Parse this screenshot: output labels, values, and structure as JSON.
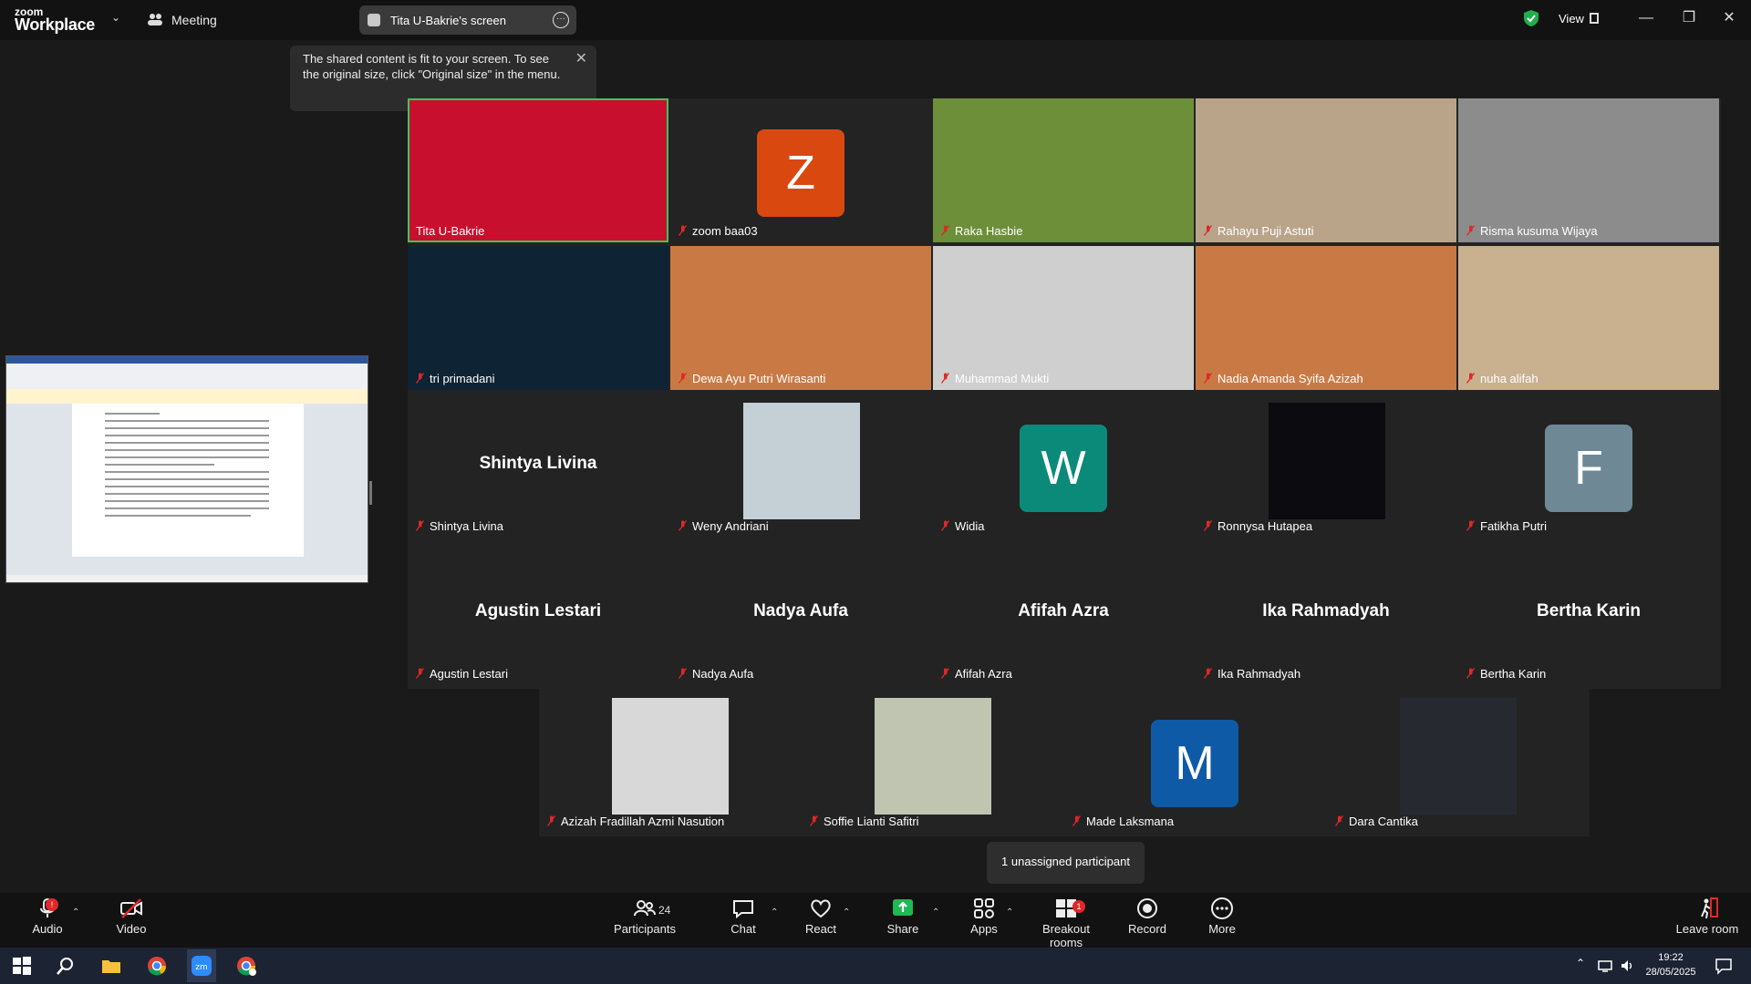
{
  "app": {
    "brand_top": "zoom",
    "brand_bottom": "Workplace",
    "meeting_label": "Meeting"
  },
  "share_pill": {
    "label": "Tita U-Bakrie's screen"
  },
  "view": {
    "label": "View"
  },
  "tooltip": {
    "text": "The shared content is fit to your screen. To see the original size, click \"Original size\" in the menu."
  },
  "tiles": [
    {
      "name": "Tita U-Bakrie",
      "type": "video",
      "bg": "#c8102e",
      "highlighted": true
    },
    {
      "name": "zoom baa03",
      "type": "avatar",
      "letter": "Z",
      "color": "#d9480f"
    },
    {
      "name": "Raka Hasbie",
      "type": "video",
      "bg": "#6d8f3a"
    },
    {
      "name": "Rahayu Puji Astuti",
      "type": "video",
      "bg": "#b9a48a"
    },
    {
      "name": "Risma kusuma Wijaya",
      "type": "video",
      "bg": "#8c8c8c"
    },
    {
      "name": "tri primadani",
      "type": "video",
      "bg": "#0e2333"
    },
    {
      "name": "Dewa Ayu Putri Wirasanti",
      "type": "video",
      "bg": "#c97a44"
    },
    {
      "name": "Muhammad Mukti",
      "type": "video",
      "bg": "#cfcfcf"
    },
    {
      "name": "Nadia Amanda Syifa Azizah",
      "type": "video",
      "bg": "#c97a44"
    },
    {
      "name": "nuha alifah",
      "type": "video",
      "bg": "#c9b08e"
    },
    {
      "name": "Shintya Livina",
      "type": "text",
      "display": "Shintya Livina"
    },
    {
      "name": "Weny Andriani",
      "type": "photo",
      "bg": "#c4cfd6"
    },
    {
      "name": "Widia",
      "type": "avatar",
      "letter": "W",
      "color": "#0b8a7a"
    },
    {
      "name": "Ronnysa Hutapea",
      "type": "photo",
      "bg": "#0c0c10"
    },
    {
      "name": "Fatikha Putri",
      "type": "avatar",
      "letter": "F",
      "color": "#6f8896"
    },
    {
      "name": "Agustin Lestari",
      "type": "text",
      "display": "Agustin Lestari"
    },
    {
      "name": "Nadya Aufa",
      "type": "text",
      "display": "Nadya Aufa"
    },
    {
      "name": "Afifah Azra",
      "type": "text",
      "display": "Afifah Azra"
    },
    {
      "name": "Ika Rahmadyah",
      "type": "text",
      "display": "Ika Rahmadyah"
    },
    {
      "name": "Bertha Karin",
      "type": "text",
      "display": "Bertha Karin"
    },
    {
      "name": "Azizah Fradillah Azmi Nasution",
      "type": "photo",
      "bg": "#d8d8d8"
    },
    {
      "name": "Soffie Lianti Safitri",
      "type": "photo",
      "bg": "#bfc5b0"
    },
    {
      "name": "Made Laksmana",
      "type": "avatar",
      "letter": "M",
      "color": "#0e5aa7"
    },
    {
      "name": "Dara Cantika",
      "type": "photo",
      "bg": "#262a30"
    }
  ],
  "notice": {
    "text": "1 unassigned participant"
  },
  "toolbar": {
    "audio": "Audio",
    "video": "Video",
    "participants": "Participants",
    "participants_count": "24",
    "chat": "Chat",
    "react": "React",
    "share": "Share",
    "apps": "Apps",
    "breakout": "Breakout rooms",
    "breakout_badge": "1",
    "record": "Record",
    "more": "More",
    "leave": "Leave room"
  },
  "taskbar": {
    "time": "19:22",
    "date": "28/05/2025"
  },
  "colors": {
    "accent_green": "#3ec55e",
    "share_green": "#1db954",
    "alert_red": "#e02828"
  }
}
